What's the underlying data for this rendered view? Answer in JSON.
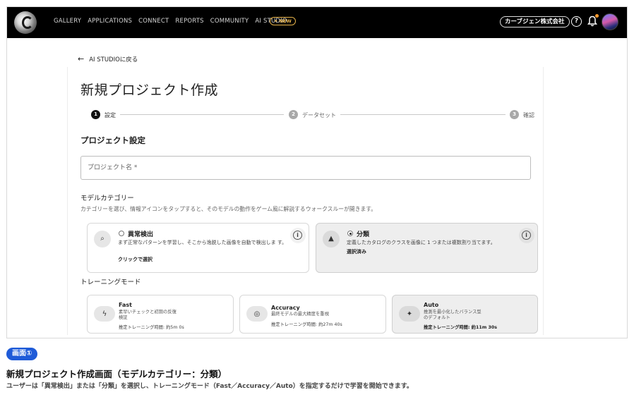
{
  "header": {
    "nav": [
      "GALLERY",
      "APPLICATIONS",
      "CONNECT",
      "REPORTS",
      "COMMUNITY",
      "AI STUDIO"
    ],
    "new_badge": "NEW",
    "company": "カーブジェン株式会社",
    "icons": [
      "logo",
      "help-icon",
      "bell-icon",
      "avatar"
    ],
    "notification_dot_color": "#ff9b2e"
  },
  "back_link": "AI STUDIOに戻る",
  "page_title": "新規プロジェクト作成",
  "stepper": [
    {
      "number": "1",
      "label": "設定",
      "active": true
    },
    {
      "number": "2",
      "label": "データセット",
      "active": false
    },
    {
      "number": "3",
      "label": "確認",
      "active": false
    }
  ],
  "project_section_title": "プロジェクト設定",
  "project_name_placeholder": "プロジェクト名 *",
  "model_category": {
    "label": "モデルカテゴリー",
    "help": "カテゴリーを選び、情報アイコンをタップすると、そのモデルの動作をゲーム風に解説するウォークスルーが開きます。",
    "options": [
      {
        "title": "異常検出",
        "desc": "まず正常なパターンを学習し、そこから逸脱した画像を自動で検出しま す。",
        "note": "クリックで選択",
        "selected": false,
        "icon": "zoom-search-icon"
      },
      {
        "title": "分類",
        "desc": "定義したカタログのクラスを画像に 1 つまたは複数割り当てます。",
        "note": "選択済み",
        "selected": true,
        "icon": "shapes-icon"
      }
    ]
  },
  "training_mode": {
    "label": "トレーニングモード",
    "options": [
      {
        "title": "Fast",
        "desc_line1": "素早いチェックと初期の反復",
        "desc_line2": "検証",
        "time": "推定トレーニング時間: 約5m 0s",
        "selected": false,
        "icon": "bolt-icon"
      },
      {
        "title": "Accuracy",
        "desc_line1": "最終モデルの最大精度を重視",
        "desc_line2": "",
        "time": "推定トレーニング時間: 約27m 40s",
        "selected": false,
        "icon": "target-icon"
      },
      {
        "title": "Auto",
        "desc_line1": "推測を最小化したバランス型",
        "desc_line2": "のデフォルト",
        "time": "推定トレーニング時間: 約11m 30s",
        "selected": true,
        "icon": "sparkle-icon"
      }
    ]
  },
  "caption": {
    "badge": "画面①",
    "title": "新規プロジェクト作成画面（モデルカテゴリー：分類）",
    "desc": "ユーザーは「異常検出」または「分類」を選択し、トレーニングモード（Fast／Accuracy／Auto）を指定するだけで学習を開始できます。"
  },
  "colors": {
    "accent": "#1f5bd8",
    "new_badge": "#e6b24a",
    "topbar": "#000000"
  }
}
